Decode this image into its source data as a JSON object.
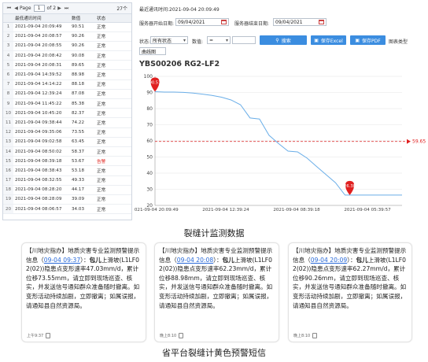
{
  "pager": {
    "page_word": "Page",
    "page_value": "1",
    "of_text": "of 2",
    "count": "27个"
  },
  "table": {
    "headers": [
      "最低通讯时间",
      "数值",
      "状态"
    ],
    "rows": [
      [
        "1",
        "2021-09-04 20:09:49",
        "90.51",
        "正常"
      ],
      [
        "2",
        "2021-09-04 20:08:57",
        "90.26",
        "正常"
      ],
      [
        "3",
        "2021-09-04 20:08:55",
        "90.26",
        "正常"
      ],
      [
        "4",
        "2021-09-04 20:08:42",
        "90.08",
        "正常"
      ],
      [
        "5",
        "2021-09-04 20:08:31",
        "89.65",
        "正常"
      ],
      [
        "6",
        "2021-09-04 14:39:52",
        "88.98",
        "正常"
      ],
      [
        "7",
        "2021-09-04 14:14:22",
        "88.18",
        "正常"
      ],
      [
        "8",
        "2021-09-04 12:39:24",
        "87.08",
        "正常"
      ],
      [
        "9",
        "2021-09-04 11:45:22",
        "85.38",
        "正常"
      ],
      [
        "10",
        "2021-09-04 10:45:20",
        "82.37",
        "正常"
      ],
      [
        "11",
        "2021-09-04 09:38:44",
        "74.22",
        "正常"
      ],
      [
        "12",
        "2021-09-04 09:35:06",
        "73.55",
        "正常"
      ],
      [
        "13",
        "2021-09-04 09:02:58",
        "63.45",
        "正常"
      ],
      [
        "14",
        "2021-09-04 08:50:02",
        "58.37",
        "正常"
      ],
      [
        "15",
        "2021-09-04 08:39:18",
        "53.67",
        "告警"
      ],
      [
        "16",
        "2021-09-04 08:38:43",
        "53.18",
        "正常"
      ],
      [
        "17",
        "2021-09-04 08:32:55",
        "49.33",
        "正常"
      ],
      [
        "18",
        "2021-09-04 08:28:20",
        "44.17",
        "正常"
      ],
      [
        "19",
        "2021-09-04 08:28:09",
        "39.09",
        "正常"
      ],
      [
        "20",
        "2021-09-04 08:06:57",
        "34.03",
        "正常"
      ]
    ]
  },
  "top": {
    "last_comm": "最近通讯时间:2021-09-04 20:09:49",
    "start_label": "服务器开始日期:",
    "start_value": "09/04/2021",
    "end_label": "服务器结束日期:",
    "end_value": "09/04/2021",
    "status_label": "状态:",
    "status_value": "所有状态",
    "value_label": "数值:",
    "value_op": "=",
    "search_btn": "搜索",
    "excel_btn": "保存Excel",
    "pdf_btn": "保存PDF",
    "chart_type_label": "图表类型",
    "chart_type_value": "曲线图",
    "accent": "#3b8de0"
  },
  "chart_data": {
    "type": "line",
    "title": "YBS00206 RG2-LF2",
    "ylim": [
      20,
      100
    ],
    "yticks": [
      20,
      30,
      40,
      50,
      60,
      70,
      80,
      90,
      100
    ],
    "xtick_labels": [
      "2021-09-04 20:09:49",
      "2021-09-04 12:39:24",
      "2021-09-04 08:39:18",
      "2021-09-04 05:39:57"
    ],
    "series": [
      {
        "values": [
          90.51,
          90.26,
          90.26,
          90.08,
          89.65,
          88.98,
          88.18,
          87.08,
          85.38,
          82.37,
          74.22,
          73.55,
          63.45,
          58.37,
          53.67,
          53.18,
          49.33,
          44.17,
          39.09,
          34.03,
          26.38,
          26.38,
          26.38,
          26.38,
          26.38,
          26.38,
          26.38
        ]
      }
    ],
    "threshold": 59.65,
    "threshold_label": "59.65",
    "max_label": "90.51",
    "min_label": "26.38",
    "line_color": "#6aaee8",
    "marker_color": "#e02020"
  },
  "captions": {
    "chart_caption": "裂缝计监测数据",
    "sms_caption": "省平台裂缝计黄色预警短信"
  },
  "sms": [
    {
      "p1": "【川地灾指办】地质灾害专业监测预警提示信息（",
      "link": "09-04 09:37",
      "p2": "）：",
      "bold": "包儿",
      "p3": "上滑坡(L1LF02(02))隐患点变形速率47.03mm/d，累计位移73.55mm，请立即到现场巡查、核实，并发送信号通知群众准备随时撤离。如变形活动持续加剧，立即撤离；如属误报，请通知县自然资源局。",
      "time": "上午9:37"
    },
    {
      "p1": "【川地灾指办】地质灾害专业监测预警提示信息（",
      "link": "09-04 20:08",
      "p2": "）：",
      "bold": "包儿",
      "p3": "上滑坡(L1LF02(02))隐患点变形速率62.23mm/d，累计位移88.98mm，请立即到现场巡查、核实，并发送信号通知群众准备随时撤离。如变形活动持续加剧，立即撤离；如属误报，请通知县自然资源局。",
      "time": "晚上8:10"
    },
    {
      "p1": "【川地灾指办】地质灾害专业监测预警提示信息（",
      "link": "09-04 20:09",
      "p2": "）：",
      "bold": "包儿",
      "p3": "上滑坡(L1LF02(02))隐患点变形速率62.27mm/d，累计位移90.26mm，请立即到现场巡查、核实，并发送信号通知群众准备随时撤离。如变形活动持续加剧，立即撤离；如属误报，请通知县自然资源局。",
      "time": "晚上8:10"
    }
  ]
}
